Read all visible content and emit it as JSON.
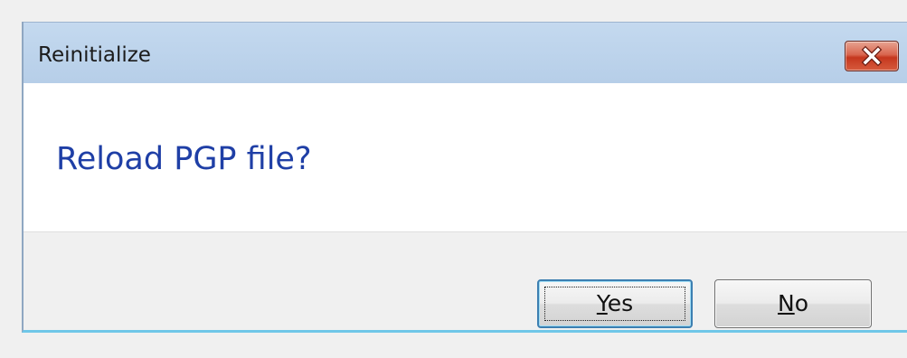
{
  "window": {
    "title": "Reinitialize",
    "close_icon": "close-icon"
  },
  "content": {
    "message": "Reload PGP file?"
  },
  "buttons": {
    "yes": {
      "mnemonic": "Y",
      "rest": "es"
    },
    "no": {
      "mnemonic": "N",
      "rest": "o"
    }
  },
  "colors": {
    "message_text": "#1f3fa6",
    "close_button": "#c5371e",
    "focus_border": "#3c7fb1"
  }
}
